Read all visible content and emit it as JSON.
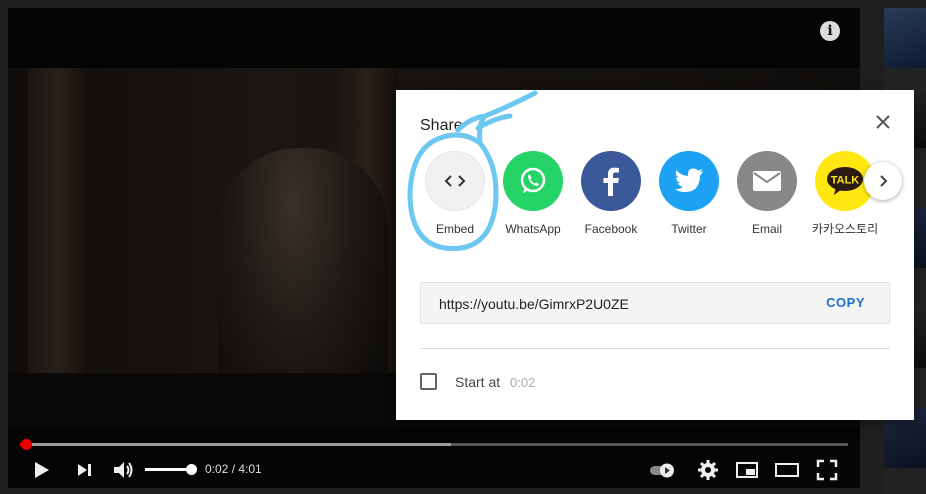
{
  "share": {
    "title": "Share",
    "items": [
      {
        "label": "Embed",
        "icon": "embed-icon",
        "color": "#f1f1f1"
      },
      {
        "label": "WhatsApp",
        "icon": "whatsapp-icon",
        "color": "#25d366"
      },
      {
        "label": "Facebook",
        "icon": "facebook-icon",
        "color": "#3b5998"
      },
      {
        "label": "Twitter",
        "icon": "twitter-icon",
        "color": "#1da1f2"
      },
      {
        "label": "Email",
        "icon": "email-icon",
        "color": "#888888"
      },
      {
        "label": "카카오스토리",
        "icon": "kakaotalk-icon",
        "color": "#ffe812",
        "badge": "TALK"
      }
    ],
    "url": "https://youtu.be/GimrxP2U0ZE",
    "copy_label": "COPY",
    "start_label": "Start at",
    "start_time": "0:02",
    "start_checked": false
  },
  "player": {
    "time_display": "0:02 / 4:01",
    "progress_fraction": 0.008,
    "buffer_fraction": 0.52,
    "volume_fraction": 1.0
  },
  "colors": {
    "accent": "#1a6fd1",
    "progress": "#ee0000",
    "annotation": "#6cc8f0"
  }
}
